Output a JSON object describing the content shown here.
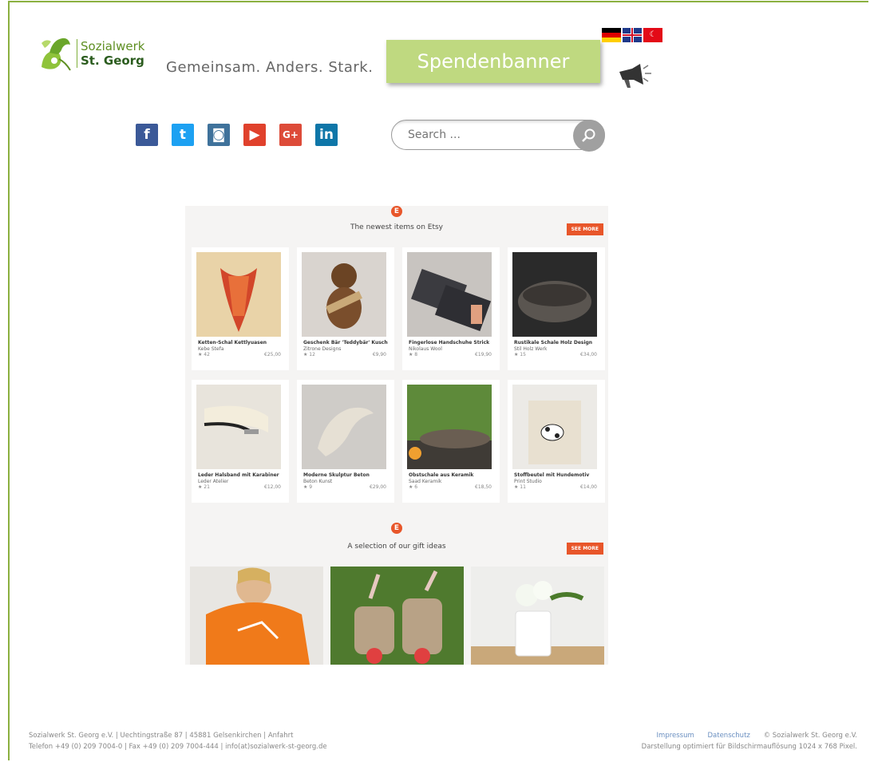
{
  "header": {
    "logo_line1": "Sozialwerk",
    "logo_line2": "St. Georg",
    "tagline": "Gemeinsam. Anders. Stark.",
    "banner_label": "Spendenbanner",
    "languages": [
      "de",
      "en",
      "tr"
    ]
  },
  "social": {
    "facebook": "f",
    "twitter": "t",
    "instagram": "◙",
    "youtube": "▶",
    "googleplus": "G+",
    "linkedin": "in"
  },
  "search": {
    "placeholder": "Search ..."
  },
  "etsy": {
    "badge": "E",
    "section1_title": "The newest items on Etsy",
    "section2_title": "A selection of our gift ideas",
    "see_more": "SEE MORE",
    "items": [
      {
        "title": "Ketten-Schal Kettlyuasen",
        "shop": "Kebe Stefa",
        "meta": "★ 42",
        "price": "€25,00"
      },
      {
        "title": "Geschenk Bär 'Teddybär' Kuschelbär",
        "shop": "Zitrone Designs",
        "meta": "★ 12",
        "price": "€9,90"
      },
      {
        "title": "Fingerlose Handschuhe Strick",
        "shop": "Nikolaus Wool",
        "meta": "★ 8",
        "price": "€19,90"
      },
      {
        "title": "Rustikale Schale Holz Design",
        "shop": "Stil Holz Werk",
        "meta": "★ 15",
        "price": "€34,00"
      },
      {
        "title": "Leder Halsband mit Karabiner",
        "shop": "Leder Atelier",
        "meta": "★ 21",
        "price": "€12,00"
      },
      {
        "title": "Moderne Skulptur Beton",
        "shop": "Beton Kunst",
        "meta": "★ 9",
        "price": "€29,00"
      },
      {
        "title": "Obstschale aus Keramik",
        "shop": "Saad Keramik",
        "meta": "★ 6",
        "price": "€18,50"
      },
      {
        "title": "Stoffbeutel mit Hundemotiv",
        "shop": "Print Studio",
        "meta": "★ 11",
        "price": "€14,00"
      }
    ]
  },
  "footer": {
    "left_line1": "Sozialwerk St. Georg e.V. | Uechtingstraße 87 | 45881 Gelsenkirchen | Anfahrt",
    "left_line2": "Telefon +49 (0) 209 7004-0 | Fax +49 (0) 209 7004-444 | info(at)sozialwerk-st-georg.de",
    "impressum": "Impressum",
    "datenschutz": "Datenschutz",
    "copyright": "© Sozialwerk St. Georg e.V.",
    "resolution": "Darstellung optimiert für Bildschirmauflösung 1024 x 768 Pixel."
  }
}
